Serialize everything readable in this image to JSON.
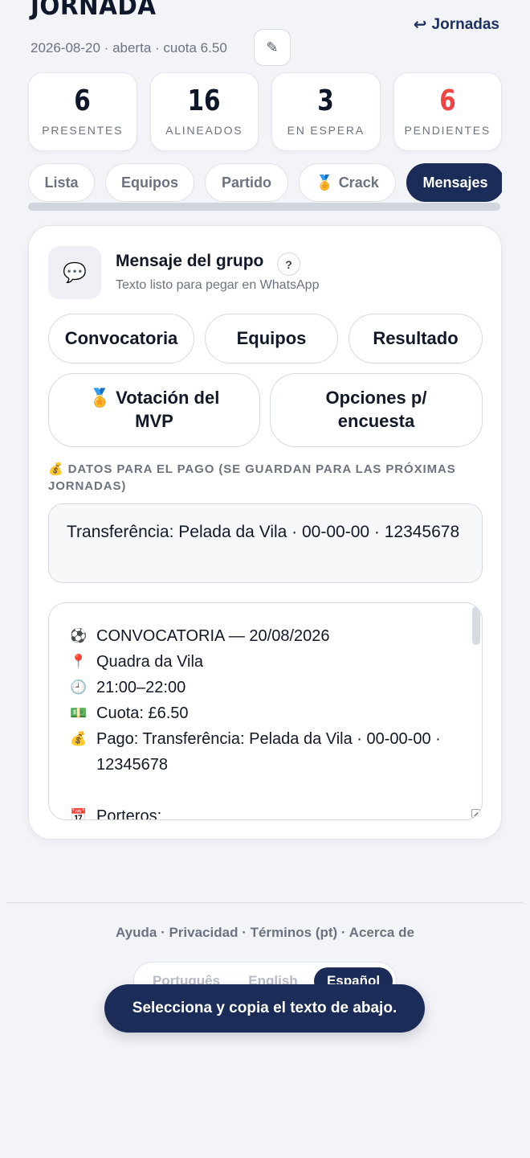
{
  "header": {
    "title": "JORNADA",
    "back_label": "Jornadas",
    "back_icon": "↩",
    "meta": "2026-08-20 · aberta · cuota 6.50",
    "edit_icon": "✎"
  },
  "stats": [
    {
      "value": "6",
      "label": "PRESENTES",
      "color": "#0f172a"
    },
    {
      "value": "16",
      "label": "ALINEADOS",
      "color": "#0f172a"
    },
    {
      "value": "3",
      "label": "EN ESPERA",
      "color": "#0f172a"
    },
    {
      "value": "6",
      "label": "PENDIENTES",
      "color": "#ef4444"
    }
  ],
  "tabs": [
    {
      "label": "Lista"
    },
    {
      "label": "Equipos"
    },
    {
      "label": "Partido"
    },
    {
      "label": "Crack",
      "icon": "🏅"
    },
    {
      "label": "Mensajes",
      "active": true
    }
  ],
  "card": {
    "icon": "💬",
    "title": "Mensaje del grupo",
    "help": "?",
    "subtitle": "Texto listo para pegar en WhatsApp",
    "templates": {
      "convocatoria": "Convocatoria",
      "equipos": "Equipos",
      "resultado": "Resultado",
      "mvp_icon": "🏅",
      "mvp": "Votación del MVP",
      "opciones": "Opciones p/ encuesta"
    },
    "payment_label_icon": "💰",
    "payment_label": "DATOS PARA EL PAGO (SE GUARDAN PARA LAS PRÓXIMAS JORNADAS)",
    "payment_value": "Transferência: Pelada da Vila · 00-00-00 · 12345678",
    "message_lines": [
      {
        "icon": "⚽",
        "text": "CONVOCATORIA — 20/08/2026"
      },
      {
        "icon": "📍",
        "text": "Quadra da Vila"
      },
      {
        "icon": "🕘",
        "text": "21:00–22:00"
      },
      {
        "icon": "💵",
        "text": "Cuota: £6.50"
      },
      {
        "icon": "💰",
        "text": "Pago: Transferência: Pelada da Vila · 00-00-00 · 12345678"
      },
      {
        "icon": "",
        "text": ""
      },
      {
        "icon": "📅",
        "text": "Porteros:"
      }
    ]
  },
  "footer": {
    "links": [
      "Ayuda",
      "Privacidad",
      "Términos (pt)",
      "Acerca de"
    ],
    "languages": [
      "Português",
      "English",
      "Español"
    ],
    "active_language": "Español"
  },
  "toast": "Selecciona y copia el texto de abajo.",
  "colors": {
    "accent": "#1a2c57",
    "danger": "#ef4444",
    "muted": "#6b7280",
    "background": "#f3f4f8"
  }
}
